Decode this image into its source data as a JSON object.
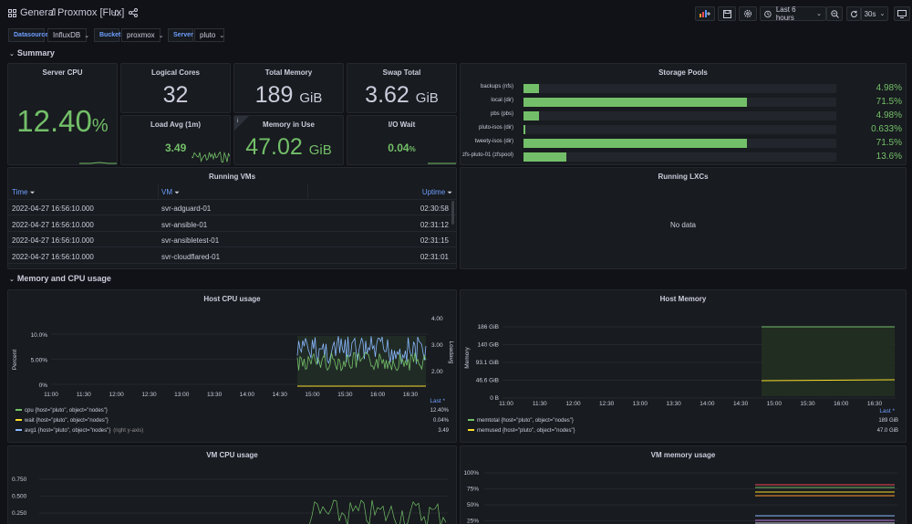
{
  "topbar": {
    "breadcrumb_root": "General",
    "breadcrumb_sep": "/",
    "dashboard_title": "Proxmox [Flux]",
    "time_range": "Last 6 hours",
    "refresh": "30s"
  },
  "variables": [
    {
      "label": "Datasource",
      "value": "InfluxDB"
    },
    {
      "label": "Bucket",
      "value": "proxmox"
    },
    {
      "label": "Server",
      "value": "pluto"
    }
  ],
  "rows": {
    "summary": "Summary",
    "mem_cpu": "Memory and CPU usage"
  },
  "stats": {
    "server_cpu": {
      "title": "Server CPU",
      "value": "12.40",
      "unit": "%"
    },
    "logical_cores": {
      "title": "Logical Cores",
      "value": "32"
    },
    "total_memory": {
      "title": "Total Memory",
      "value": "189",
      "unit": "GiB"
    },
    "swap_total": {
      "title": "Swap Total",
      "value": "3.62",
      "unit": "GiB"
    },
    "load_avg": {
      "title": "Load Avg (1m)",
      "value": "3.49"
    },
    "memory_in_use": {
      "title": "Memory in Use",
      "value": "47.02",
      "unit": "GiB",
      "info": "i"
    },
    "io_wait": {
      "title": "I/O Wait",
      "value": "0.04",
      "unit": "%"
    }
  },
  "storage": {
    "title": "Storage Pools",
    "pools": [
      {
        "name": "backups (nfs)",
        "pct": 4.98,
        "label": "4.98%"
      },
      {
        "name": "local (dir)",
        "pct": 71.5,
        "label": "71.5%"
      },
      {
        "name": "pbs (pbs)",
        "pct": 4.98,
        "label": "4.98%"
      },
      {
        "name": "pluto-isos (dir)",
        "pct": 0.633,
        "label": "0.633%"
      },
      {
        "name": "tweety-isos (dir)",
        "pct": 71.5,
        "label": "71.5%"
      },
      {
        "name": "zfs-pluto-01 (zfspool)",
        "pct": 13.6,
        "label": "13.6%"
      }
    ]
  },
  "running_vms": {
    "title": "Running VMs",
    "columns": [
      "Time",
      "VM",
      "Uptime"
    ],
    "rows": [
      [
        "2022-04-27 16:56:10.000",
        "svr-adguard-01",
        "02:30:58"
      ],
      [
        "2022-04-27 16:56:10.000",
        "svr-ansible-01",
        "02:31:12"
      ],
      [
        "2022-04-27 16:56:10.000",
        "svr-ansibletest-01",
        "02:31:15"
      ],
      [
        "2022-04-27 16:56:10.000",
        "svr-cloudflared-01",
        "02:31:01"
      ]
    ]
  },
  "running_lxcs": {
    "title": "Running LXCs",
    "empty": "No data"
  },
  "host_cpu": {
    "title": "Host CPU usage",
    "y_left_ticks": [
      "10.0%",
      "5.00%",
      "0%"
    ],
    "y_right_ticks": [
      "4.00",
      "3.00",
      "2.00"
    ],
    "y_left_label": "Percent",
    "y_right_label": "Loadavg",
    "x_ticks": [
      "11:00",
      "11:30",
      "12:00",
      "12:30",
      "13:00",
      "13:30",
      "14:00",
      "14:30",
      "15:00",
      "15:30",
      "16:00",
      "16:30"
    ],
    "legend_header": "Last *",
    "legend": [
      {
        "name": "cpu {host=\"pluto\", object=\"nodes\"}",
        "value": "12.40%",
        "color": "#73bf69"
      },
      {
        "name": "wait {host=\"pluto\", object=\"nodes\"}",
        "value": "0.04%",
        "color": "#fade2a"
      },
      {
        "name": "avg1 {host=\"pluto\", object=\"nodes\"}",
        "suffix": "(right y-axis)",
        "value": "3.49",
        "color": "#8ab8ff"
      }
    ]
  },
  "host_memory": {
    "title": "Host Memory",
    "y_ticks": [
      "186 GiB",
      "140 GiB",
      "93.1 GiB",
      "46.6 GiB",
      "0 B"
    ],
    "y_label": "Memory",
    "x_ticks": [
      "11:00",
      "11:30",
      "12:00",
      "12:30",
      "13:00",
      "13:30",
      "14:00",
      "14:30",
      "15:00",
      "15:30",
      "16:00",
      "16:30"
    ],
    "legend_header": "Last *",
    "legend": [
      {
        "name": "memtotal {host=\"pluto\", object=\"nodes\"}",
        "value": "189 GiB",
        "color": "#73bf69"
      },
      {
        "name": "memused {host=\"pluto\", object=\"nodes\"}",
        "value": "47.0 GiB",
        "color": "#fade2a"
      }
    ]
  },
  "vm_cpu": {
    "title": "VM CPU usage",
    "y_ticks": [
      "0.750",
      "0.500",
      "0.250"
    ]
  },
  "vm_memory": {
    "title": "VM memory usage",
    "y_ticks": [
      "100%",
      "75%",
      "50%",
      "25%"
    ]
  },
  "colors": {
    "green": "#73bf69",
    "yellow": "#fade2a",
    "blue": "#8ab8ff",
    "accent": "#6e9fff"
  }
}
